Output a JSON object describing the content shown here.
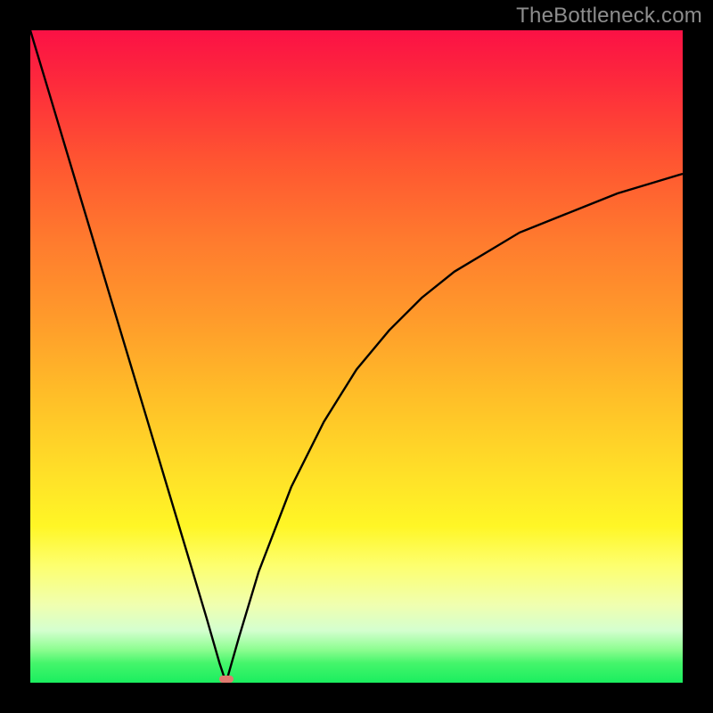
{
  "watermark": "TheBottleneck.com",
  "colors": {
    "frame": "#000000",
    "gradient_top": "#fb1145",
    "gradient_bottom": "#1aee5f",
    "curve": "#000000",
    "bump": "#e07a6f",
    "watermark_text": "#8d8d8d"
  },
  "chart_data": {
    "type": "line",
    "title": "",
    "xlabel": "",
    "ylabel": "",
    "xlim": [
      0,
      100
    ],
    "ylim": [
      0,
      100
    ],
    "grid": false,
    "legend": false,
    "annotations": [
      "TheBottleneck.com"
    ],
    "notch_x": 30,
    "notch_marker": {
      "x": 30,
      "y": 0,
      "color": "#e07a6f"
    },
    "series": [
      {
        "name": "left-branch",
        "x": [
          0,
          3,
          6,
          9,
          12,
          15,
          18,
          21,
          24,
          27,
          29,
          30
        ],
        "y": [
          100,
          90,
          80,
          70,
          60,
          50,
          40,
          30,
          20,
          10,
          3,
          0
        ]
      },
      {
        "name": "right-branch",
        "x": [
          30,
          32,
          35,
          40,
          45,
          50,
          55,
          60,
          65,
          70,
          75,
          80,
          85,
          90,
          95,
          100
        ],
        "y": [
          0,
          7,
          17,
          30,
          40,
          48,
          54,
          59,
          63,
          66,
          69,
          71,
          73,
          75,
          76.5,
          78
        ]
      }
    ]
  }
}
